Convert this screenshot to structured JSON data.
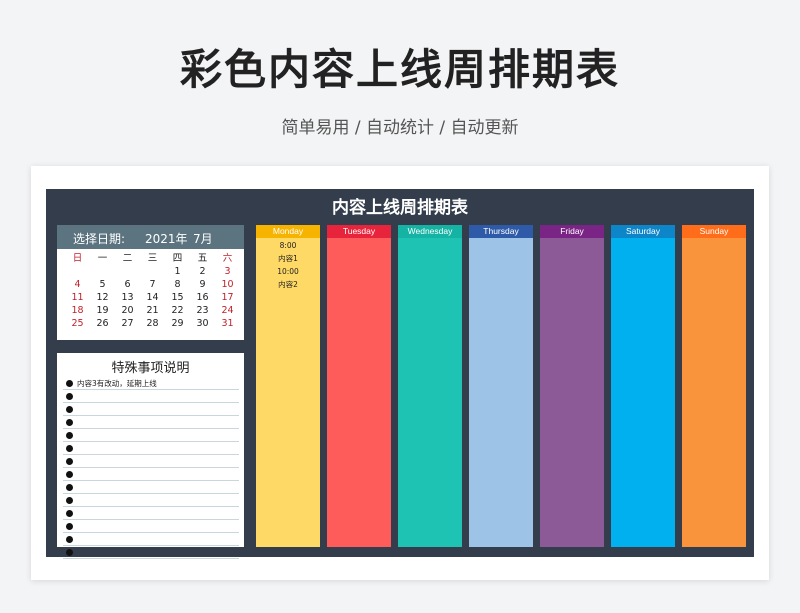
{
  "page": {
    "title": "彩色内容上线周排期表",
    "subtitle": "简单易用 / 自动统计 / 自动更新"
  },
  "board": {
    "title": "内容上线周排期表"
  },
  "calendar": {
    "select_label": "选择日期:",
    "year": "2021年",
    "month": "7月",
    "weekdays": [
      "日",
      "一",
      "二",
      "三",
      "四",
      "五",
      "六"
    ],
    "days": [
      [
        "",
        "",
        "",
        "",
        "1",
        "2",
        "3"
      ],
      [
        "4",
        "5",
        "6",
        "7",
        "8",
        "9",
        "10"
      ],
      [
        "11",
        "12",
        "13",
        "14",
        "15",
        "16",
        "17"
      ],
      [
        "18",
        "19",
        "20",
        "21",
        "22",
        "23",
        "24"
      ],
      [
        "25",
        "26",
        "27",
        "28",
        "29",
        "30",
        "31"
      ]
    ],
    "colors": {
      "header_bg": "#5c7480",
      "weekend": "#c0202a"
    }
  },
  "notes": {
    "title": "特殊事项说明",
    "items": [
      "内容3有改动，延期上线",
      "",
      "",
      "",
      "",
      "",
      "",
      "",
      "",
      "",
      "",
      "",
      "",
      ""
    ]
  },
  "days": [
    {
      "name": "Monday",
      "head_color": "#f6b300",
      "body_color": "#ffd966",
      "entries": [
        "8:00",
        "内容1",
        "10:00",
        "内容2"
      ]
    },
    {
      "name": "Tuesday",
      "head_color": "#e8243c",
      "body_color": "#fd5c5a",
      "entries": []
    },
    {
      "name": "Wednesday",
      "head_color": "#14b3a3",
      "body_color": "#1fc3b3",
      "entries": []
    },
    {
      "name": "Thursday",
      "head_color": "#2e5aa8",
      "body_color": "#9dc3e6",
      "entries": []
    },
    {
      "name": "Friday",
      "head_color": "#7a2585",
      "body_color": "#8b5a97",
      "entries": []
    },
    {
      "name": "Saturday",
      "head_color": "#0d85c9",
      "body_color": "#00b0ef",
      "entries": []
    },
    {
      "name": "Sunday",
      "head_color": "#ff6d1a",
      "body_color": "#f9943d",
      "entries": []
    }
  ]
}
